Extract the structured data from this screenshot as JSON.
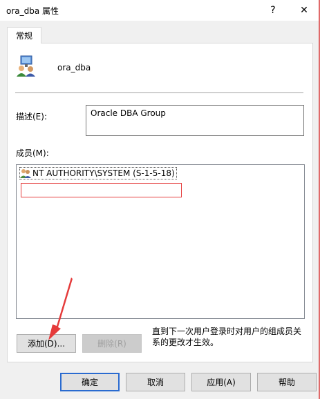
{
  "window": {
    "title": "ora_dba 属性",
    "help_glyph": "?",
    "close_glyph": "✕"
  },
  "tabs": [
    {
      "label": "常规"
    }
  ],
  "group": {
    "name": "ora_dba"
  },
  "description": {
    "label": "描述(E):",
    "value": "Oracle DBA Group"
  },
  "members": {
    "label": "成员(M):",
    "items": [
      {
        "name": "NT AUTHORITY\\SYSTEM (S-1-5-18)"
      }
    ]
  },
  "actions": {
    "add_label": "添加(D)...",
    "remove_label": "删除(R)"
  },
  "note": "直到下一次用户登录时对用户的组成员关系的更改才生效。",
  "footer": {
    "ok_label": "确定",
    "cancel_label": "取消",
    "apply_label": "应用(A)",
    "help_label": "帮助"
  },
  "colors": {
    "annotation_red": "#e53b3b",
    "default_button_border": "#2a6bd0"
  }
}
